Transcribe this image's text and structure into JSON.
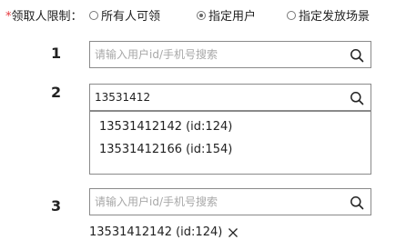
{
  "restriction": {
    "required_mark": "*",
    "label": "领取人限制：",
    "options": [
      {
        "label": "所有人可领",
        "checked": false
      },
      {
        "label": "指定用户",
        "checked": true
      },
      {
        "label": "指定发放场景",
        "checked": false
      }
    ]
  },
  "steps": {
    "step1": {
      "number": "1",
      "search_placeholder": "请输入用户id/手机号搜索",
      "search_value": ""
    },
    "step2": {
      "number": "2",
      "search_placeholder": "请输入用户id/手机号搜索",
      "search_value": "13531412",
      "results": [
        "13531412142 (id:124)",
        "13531412166 (id:154)"
      ]
    },
    "step3": {
      "number": "3",
      "search_placeholder": "请输入用户id/手机号搜索",
      "search_value": "",
      "selected_tag": "13531412142 (id:124)"
    }
  },
  "icons": {
    "search": "search-icon",
    "close": "close-icon"
  }
}
